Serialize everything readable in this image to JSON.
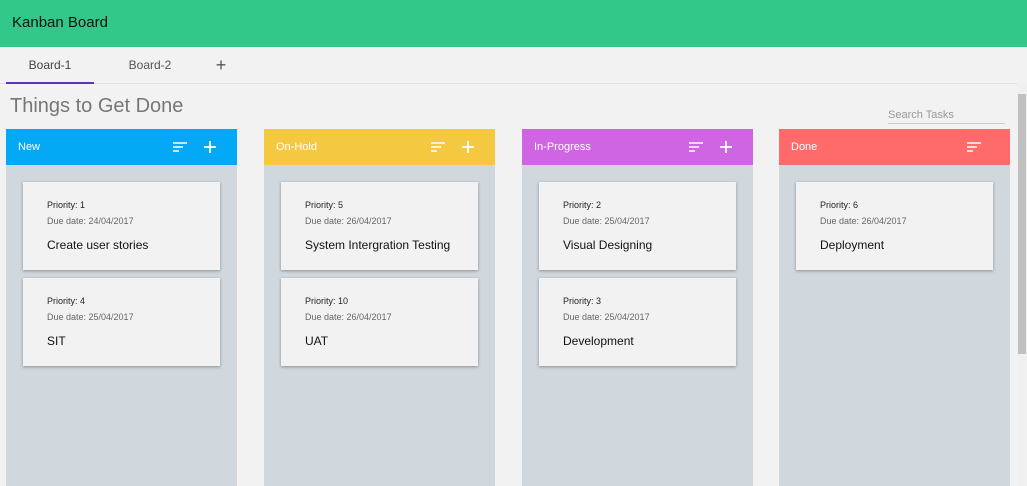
{
  "app": {
    "title": "Kanban Board"
  },
  "tabs": [
    {
      "label": "Board-1"
    },
    {
      "label": "Board-2"
    }
  ],
  "add_tab_icon": "plus-icon",
  "page_title": "Things to Get Done",
  "search": {
    "placeholder": "Search Tasks",
    "value": ""
  },
  "colors": {
    "appbar": "#31c88a",
    "active_tab_indicator": "#5e35b1",
    "new": "#03a9f4",
    "on_hold": "#f5c842",
    "in_progress": "#d065e3",
    "done": "#ff6b6b",
    "column_body": "#d0d8de"
  },
  "columns": [
    {
      "name": "New",
      "has_add": true,
      "cards": [
        {
          "priority": "Priority: 1",
          "due": "Due date: 24/04/2017",
          "title": "Create user stories"
        },
        {
          "priority": "Priority: 4",
          "due": "Due date: 25/04/2017",
          "title": "SIT"
        }
      ]
    },
    {
      "name": "On-Hold",
      "has_add": true,
      "cards": [
        {
          "priority": "Priority: 5",
          "due": "Due date: 26/04/2017",
          "title": "System Intergration Testing"
        },
        {
          "priority": "Priority: 10",
          "due": "Due date: 26/04/2017",
          "title": "UAT"
        }
      ]
    },
    {
      "name": "In-Progress",
      "has_add": true,
      "cards": [
        {
          "priority": "Priority: 2",
          "due": "Due date: 25/04/2017",
          "title": "Visual Designing"
        },
        {
          "priority": "Priority: 3",
          "due": "Due date: 25/04/2017",
          "title": "Development"
        }
      ]
    },
    {
      "name": "Done",
      "has_add": false,
      "cards": [
        {
          "priority": "Priority: 6",
          "due": "Due date: 26/04/2017",
          "title": "Deployment"
        }
      ]
    }
  ]
}
